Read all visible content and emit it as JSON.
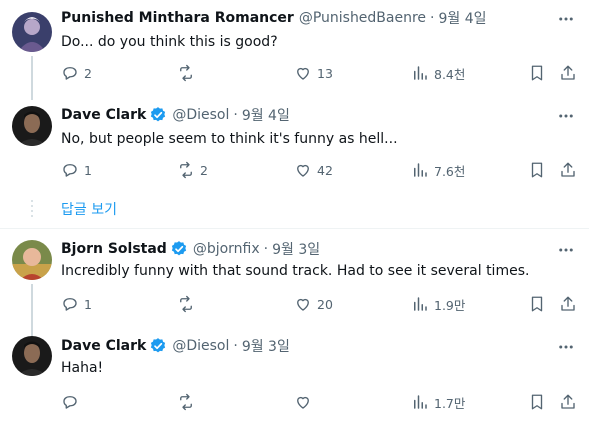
{
  "tweets": [
    {
      "name": "Punished Minthara Romancer",
      "handle": "@PunishedBaenre",
      "sep": "·",
      "time": "9월 4일",
      "text": "Do... do you think this is good?",
      "replies": "2",
      "retweets": "",
      "likes": "13",
      "views": "8.4천",
      "verified": false
    },
    {
      "name": "Dave Clark",
      "handle": "@Diesol",
      "sep": "·",
      "time": "9월 4일",
      "text": "No, but people seem to think it's funny as hell...",
      "replies": "1",
      "retweets": "2",
      "likes": "42",
      "views": "7.6천",
      "verified": true
    },
    {
      "name": "Bjorn Solstad",
      "handle": "@bjornfix",
      "sep": "·",
      "time": "9월 3일",
      "text": "Incredibly funny with that sound track. Had to see it several times.",
      "replies": "1",
      "retweets": "",
      "likes": "20",
      "views": "1.9만",
      "verified": true
    },
    {
      "name": "Dave Clark",
      "handle": "@Diesol",
      "sep": "·",
      "time": "9월 3일",
      "text": "Haha!",
      "replies": "",
      "retweets": "",
      "likes": "",
      "views": "1.7만",
      "verified": true
    }
  ],
  "show_replies_label": "답글 보기",
  "colors": {
    "accent": "#1d9bf0",
    "secondary_text": "#536471",
    "thread_line": "#cfd9de"
  },
  "icons": [
    "reply-icon",
    "retweet-icon",
    "like-icon",
    "views-icon",
    "bookmark-icon",
    "share-icon",
    "more-icon",
    "verified-badge-icon"
  ]
}
